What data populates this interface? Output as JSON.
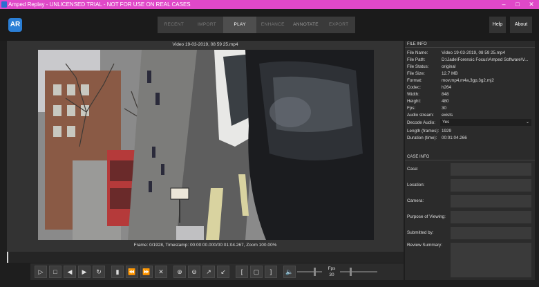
{
  "window": {
    "title": "Amped Replay - UNLICENSED TRIAL - NOT FOR USE ON REAL CASES"
  },
  "app": {
    "logo_text": "AR"
  },
  "tabs": [
    {
      "label": "RECENT"
    },
    {
      "label": "IMPORT"
    },
    {
      "label": "PLAY"
    },
    {
      "label": "ENHANCE"
    },
    {
      "label": "ANNOTATE"
    },
    {
      "label": "EXPORT"
    }
  ],
  "header": {
    "help_label": "Help",
    "about_label": "About"
  },
  "player": {
    "video_title": "Video 19-03-2019, 08 59 25.mp4",
    "frame_info": "Frame: 0/1928, Timestamp: 00:00:00.000/00:01:04.267,  Zoom 100.00%",
    "fps_label": "Fps",
    "fps_value": "30"
  },
  "file_info": {
    "heading": "FILE INFO",
    "rows": [
      {
        "label": "File Name:",
        "value": "Video 19-03-2019, 08 59 25.mp4"
      },
      {
        "label": "File Path:",
        "value": "D:\\Jade\\Forensic Focus\\Amped Software\\V..."
      },
      {
        "label": "File Status:",
        "value": "original"
      },
      {
        "label": "File Size:",
        "value": "12.7 MB"
      },
      {
        "label": "Format:",
        "value": "mov,mp4,m4a,3gp,3g2,mj2"
      },
      {
        "label": "Codec:",
        "value": "h264"
      },
      {
        "label": "Width:",
        "value": "848"
      },
      {
        "label": "Height:",
        "value": "480"
      },
      {
        "label": "Fps:",
        "value": "30"
      },
      {
        "label": "Audio stream:",
        "value": "exists"
      }
    ],
    "decode_audio_label": "Decode Audio:",
    "decode_audio_value": "Yes",
    "length_label": "Length (frames):",
    "length_value": "1929",
    "duration_label": "Duration (time):",
    "duration_value": "00:01:04.266"
  },
  "case_info": {
    "heading": "CASE INFO",
    "fields": [
      {
        "label": "Case:"
      },
      {
        "label": "Location:"
      },
      {
        "label": "Camera:"
      },
      {
        "label": "Purpose of Viewing:"
      },
      {
        "label": "Submitted by:"
      },
      {
        "label": "Review Summary:"
      }
    ]
  },
  "icons": {
    "play": "play-icon",
    "stop": "stop-icon",
    "prev": "skip-back-icon",
    "next": "skip-forward-icon",
    "loop": "loop-icon",
    "bookmark": "bookmark-icon",
    "rewind": "rewind-icon",
    "ff": "fast-forward-icon",
    "close": "close-icon",
    "zoom_in": "zoom-in-icon",
    "zoom_out": "zoom-out-icon",
    "fit": "fit-icon",
    "shrink": "shrink-icon",
    "volume": "volume-icon"
  }
}
